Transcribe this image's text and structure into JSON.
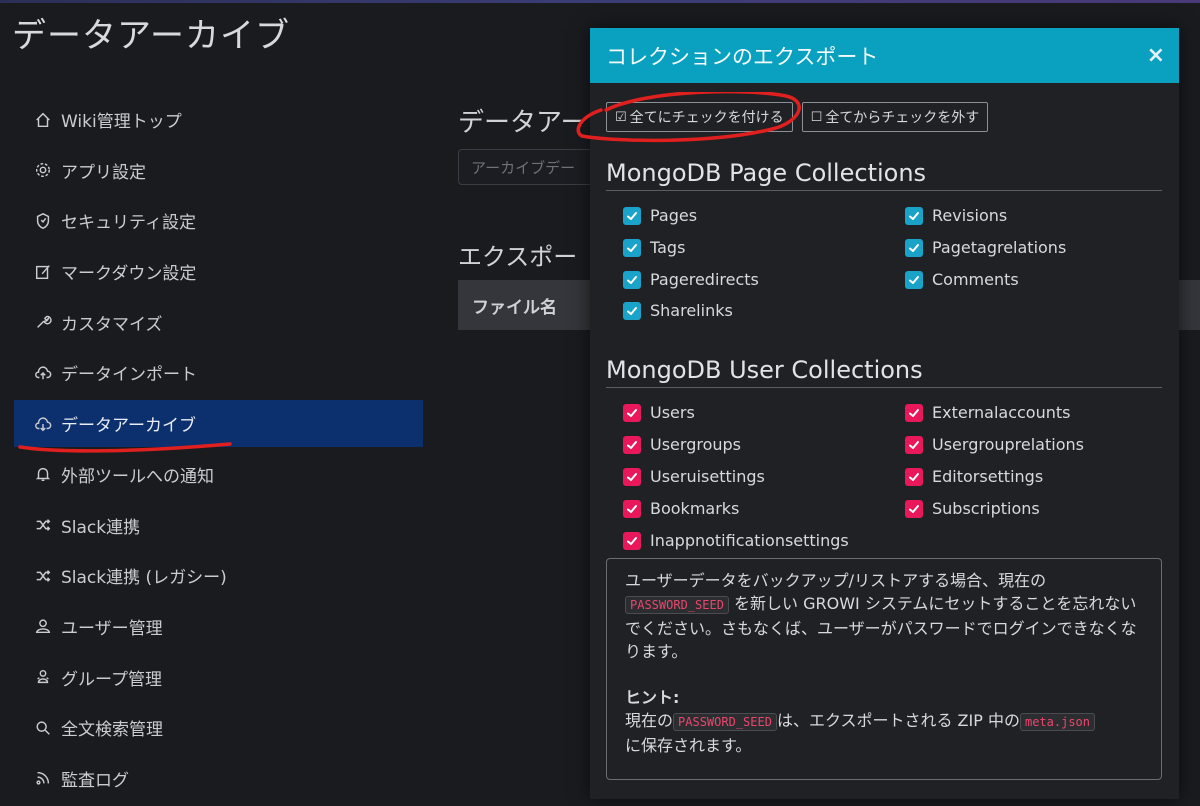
{
  "page": {
    "title": "データアーカイブ"
  },
  "sidebar": {
    "items": [
      {
        "label": "Wiki管理トップ",
        "icon": "home-icon"
      },
      {
        "label": "アプリ設定",
        "icon": "gear-icon"
      },
      {
        "label": "セキュリティ設定",
        "icon": "shield-icon"
      },
      {
        "label": "マークダウン設定",
        "icon": "edit-icon"
      },
      {
        "label": "カスタマイズ",
        "icon": "wrench-icon"
      },
      {
        "label": "データインポート",
        "icon": "cloud-upload-icon"
      },
      {
        "label": "データアーカイブ",
        "icon": "cloud-download-icon",
        "active": true
      },
      {
        "label": "外部ツールへの通知",
        "icon": "bell-icon"
      },
      {
        "label": "Slack連携",
        "icon": "shuffle-icon"
      },
      {
        "label": "Slack連携 (レガシー)",
        "icon": "shuffle-icon"
      },
      {
        "label": "ユーザー管理",
        "icon": "user-icon"
      },
      {
        "label": "グループ管理",
        "icon": "group-icon"
      },
      {
        "label": "全文検索管理",
        "icon": "search-icon"
      },
      {
        "label": "監査ログ",
        "icon": "feed-icon"
      }
    ]
  },
  "main": {
    "heading": "データアー",
    "input_placeholder": "アーカイブデー",
    "export_heading": "エクスポー",
    "table_header": "ファイル名"
  },
  "modal": {
    "title": "コレクションのエクスポート",
    "close_label": "×",
    "check_all_label": "全てにチェックを付ける",
    "uncheck_all_label": "全てからチェックを外す",
    "page_section": {
      "title": "MongoDB Page Collections",
      "items": [
        "Pages",
        "Revisions",
        "Tags",
        "Pagetagrelations",
        "Pageredirects",
        "Comments",
        "Sharelinks"
      ]
    },
    "user_section": {
      "title": "MongoDB User Collections",
      "items": [
        "Users",
        "Externalaccounts",
        "Usergroups",
        "Usergrouprelations",
        "Useruisettings",
        "Editorsettings",
        "Bookmarks",
        "Subscriptions",
        "Inappnotificationsettings"
      ]
    },
    "alert": {
      "line1": "ユーザーデータをバックアップ/リストアする場合、現在の",
      "code1": "PASSWORD_SEED",
      "line2": "を新しい GROWI システムにセットすることを忘れないでください。さもなくば、ユーザーがパスワードでログインできなくなります。",
      "hint_title": "ヒント:",
      "hint_pre": "現在の",
      "hint_code1": "PASSWORD_SEED",
      "hint_mid": "は、エクスポートされる ZIP 中の",
      "hint_code2": "meta.json",
      "hint_post": "に保存されます。"
    }
  },
  "colors": {
    "accent_cyan": "#0aa0c0",
    "page_checkbox": "#1aa3c8",
    "user_checkbox": "#e8185a",
    "sidebar_active": "#0c2f6e",
    "annotation_red": "#e0201e"
  }
}
